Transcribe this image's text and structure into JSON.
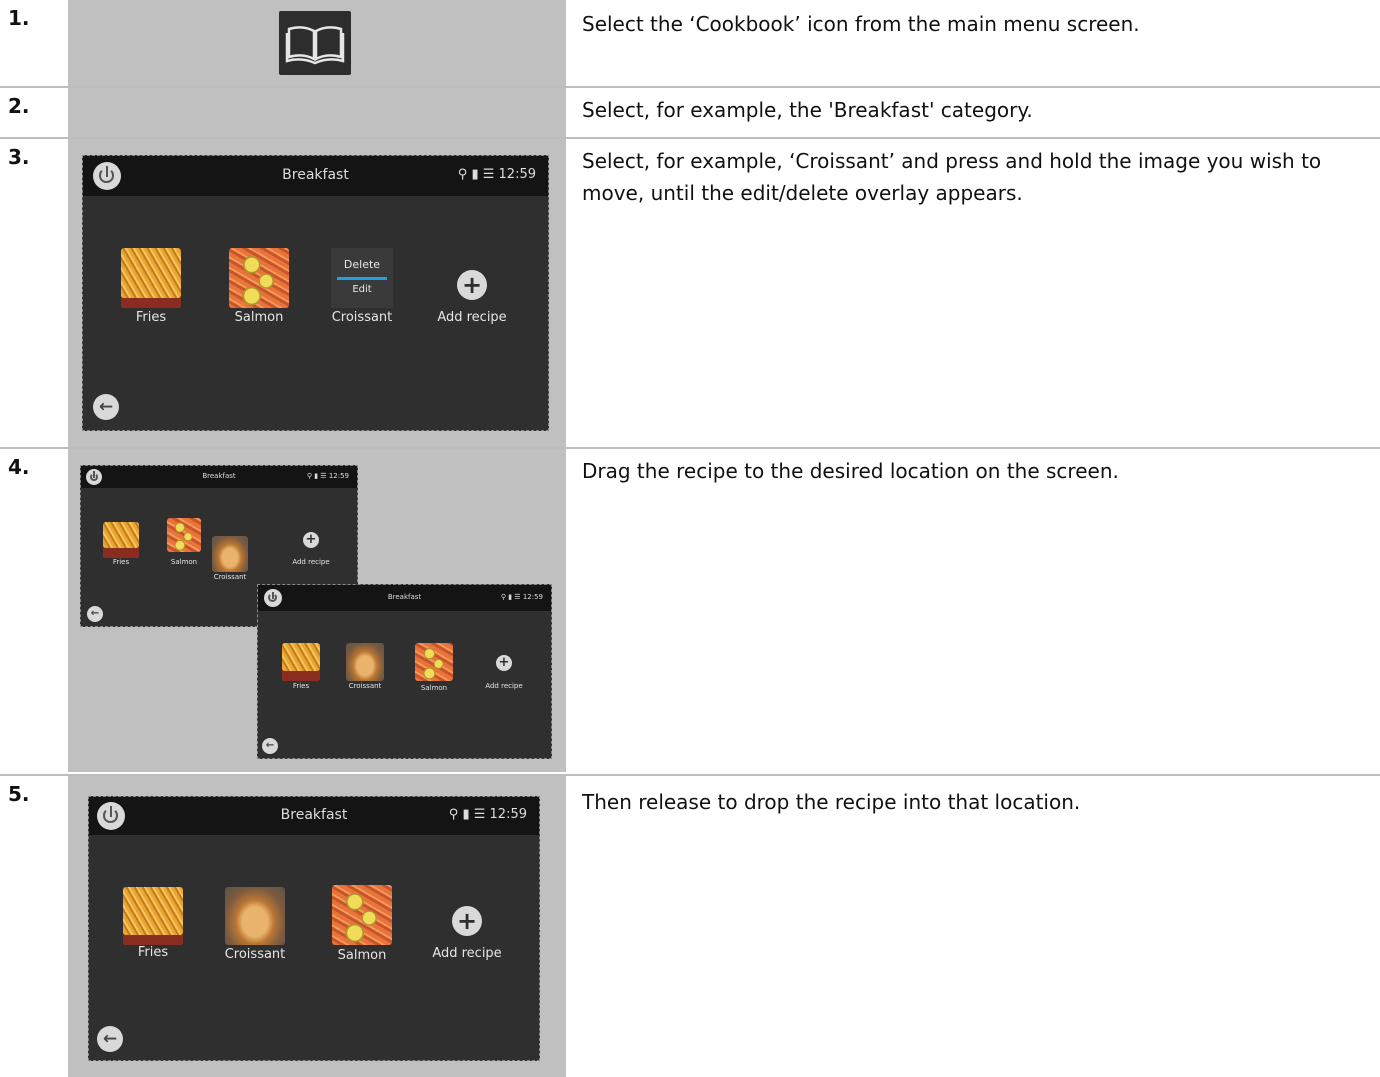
{
  "steps": [
    {
      "num": "1.",
      "text": "Select the ‘Cookbook’ icon from the main menu screen."
    },
    {
      "num": "2.",
      "text": "Select, for example, the 'Breakfast' category."
    },
    {
      "num": "3.",
      "text": "Select, for example, ‘Croissant’ and press and hold the image you wish to move, until the edit/delete overlay appears."
    },
    {
      "num": "4.",
      "text": "Drag the recipe to the desired location on the screen."
    },
    {
      "num": "5.",
      "text": "Then release to drop the recipe into that location."
    }
  ],
  "screen": {
    "title": "Breakfast",
    "time": "12:59",
    "add_recipe": "Add recipe",
    "overlay_delete": "Delete",
    "overlay_edit": "Edit"
  },
  "recipes": {
    "fries": "Fries",
    "salmon": "Salmon",
    "croissant": "Croissant"
  },
  "icons": [
    "book-icon",
    "power-icon",
    "back-arrow-icon",
    "user-icon",
    "lock-icon",
    "wifi-icon",
    "plus-icon"
  ]
}
